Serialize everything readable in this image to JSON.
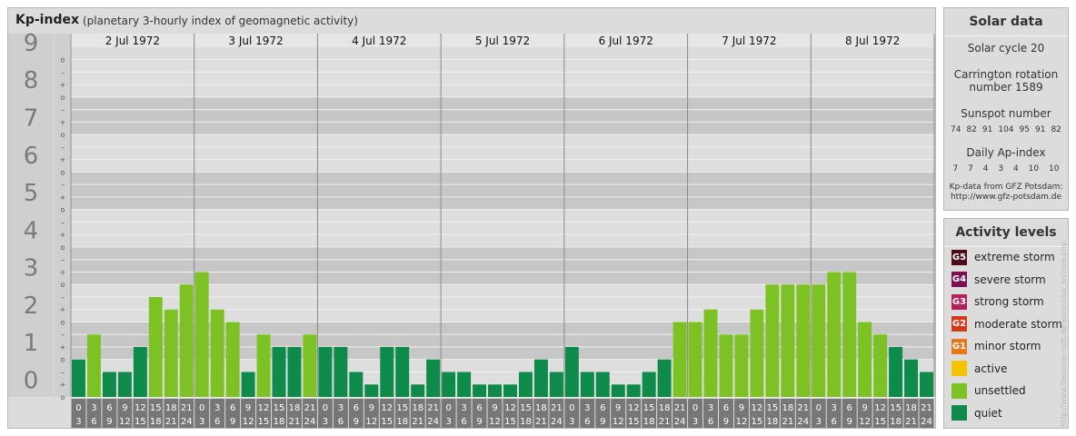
{
  "title": {
    "main": "Kp-index",
    "sub": "(planetary 3-hourly index of geomagnetic activity)"
  },
  "chart_data": {
    "type": "bar",
    "y_ticks": [
      "0",
      "1",
      "2",
      "3",
      "4",
      "5",
      "6",
      "7",
      "8",
      "9"
    ],
    "subticks": [
      "+",
      "o",
      "–"
    ],
    "ylim": [
      0,
      9.33
    ],
    "days": [
      "2 Jul 1972",
      "3 Jul 1972",
      "4 Jul 1972",
      "5 Jul 1972",
      "6 Jul 1972",
      "7 Jul 1972",
      "8 Jul 1972"
    ],
    "hour_labels": [
      [
        "0",
        "3"
      ],
      [
        "3",
        "6"
      ],
      [
        "6",
        "9"
      ],
      [
        "9",
        "12"
      ],
      [
        "12",
        "15"
      ],
      [
        "15",
        "18"
      ],
      [
        "18",
        "21"
      ],
      [
        "21",
        "24"
      ]
    ],
    "values": [
      1,
      1.667,
      0.667,
      0.667,
      1.333,
      2.667,
      2.333,
      3,
      3.333,
      2.333,
      2,
      0.667,
      1.667,
      1.333,
      1.333,
      1.667,
      1.333,
      1.333,
      0.667,
      0.333,
      1.333,
      1.333,
      0.333,
      1,
      0.667,
      0.667,
      0.333,
      0.333,
      0.333,
      0.667,
      1,
      0.667,
      1.333,
      0.667,
      0.667,
      0.333,
      0.333,
      0.667,
      1,
      2,
      2,
      2.333,
      1.667,
      1.667,
      2.333,
      3,
      3,
      3,
      3,
      3.333,
      3.333,
      2,
      1.667,
      1.333,
      1,
      0.667
    ],
    "grid": true
  },
  "solar": {
    "title": "Solar data",
    "cycle": "Solar cycle 20",
    "rotation_line1": "Carrington rotation",
    "rotation_line2": "number 1589",
    "sunspot_label": "Sunspot number",
    "sunspot_values": [
      "74",
      "82",
      "91",
      "104",
      "95",
      "91",
      "82"
    ],
    "ap_label": "Daily Ap-index",
    "ap_values": [
      "7",
      "7",
      "4",
      "3",
      "4",
      "10",
      "10"
    ],
    "credit_line1": "Kp-data from GFZ Potsdam:",
    "credit_line2": "http://www.gfz-potsdam.de"
  },
  "activity": {
    "title": "Activity levels",
    "levels": [
      {
        "badge": "G5",
        "label": "extreme storm",
        "color": "#4a0a1a"
      },
      {
        "badge": "G4",
        "label": "severe storm",
        "color": "#7a1050"
      },
      {
        "badge": "G3",
        "label": "strong storm",
        "color": "#b4215a"
      },
      {
        "badge": "G2",
        "label": "moderate storm",
        "color": "#d43a1a"
      },
      {
        "badge": "G1",
        "label": "minor storm",
        "color": "#e8761a"
      },
      {
        "badge": "",
        "label": "active",
        "color": "#f5c400"
      },
      {
        "badge": "",
        "label": "unsettled",
        "color": "#7dc224"
      },
      {
        "badge": "",
        "label": "quiet",
        "color": "#0e8a4a"
      }
    ]
  },
  "colors": {
    "quiet": "#0e8a4a",
    "unsettled": "#7dc224",
    "band_dark": "#c7c7c7",
    "band_light": "#dedede",
    "label_col": "#cfcfcf"
  },
  "watermark": "http://www.theusner-soft.de/aurora/kp_archive.php"
}
